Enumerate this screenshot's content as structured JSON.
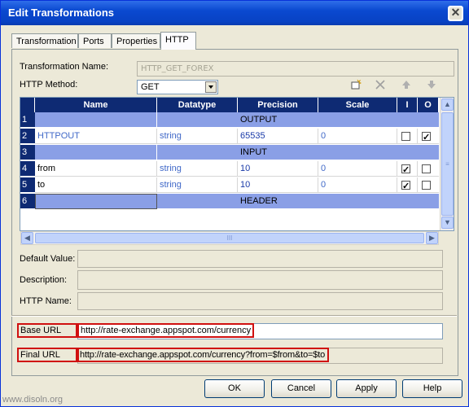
{
  "window": {
    "title": "Edit Transformations",
    "close_glyph": "✕"
  },
  "tabs": [
    {
      "label": "Transformation"
    },
    {
      "label": "Ports"
    },
    {
      "label": "Properties"
    },
    {
      "label": "HTTP"
    }
  ],
  "form": {
    "transformation_name_label": "Transformation Name:",
    "transformation_name_value": "HTTP_GET_FOREX",
    "http_method_label": "HTTP Method:",
    "http_method_value": "GET"
  },
  "toolbar_icons": [
    "new-port-icon",
    "delete-icon",
    "move-up-icon",
    "move-down-icon"
  ],
  "grid": {
    "columns": [
      "Name",
      "Datatype",
      "Precision",
      "Scale",
      "I",
      "O"
    ],
    "rows": [
      {
        "num": "1",
        "group": "OUTPUT"
      },
      {
        "num": "2",
        "name": "HTTPOUT",
        "datatype": "string",
        "precision": "65535",
        "scale": "0",
        "i": false,
        "o": true
      },
      {
        "num": "3",
        "group": "INPUT"
      },
      {
        "num": "4",
        "name": "from",
        "datatype": "string",
        "precision": "10",
        "scale": "0",
        "i": true,
        "o": false
      },
      {
        "num": "5",
        "name": "to",
        "datatype": "string",
        "precision": "10",
        "scale": "0",
        "i": true,
        "o": false
      },
      {
        "num": "6",
        "group": "HEADER"
      }
    ],
    "hscroll_grip": "III"
  },
  "details": {
    "default_value_label": "Default Value:",
    "description_label": "Description:",
    "http_name_label": "HTTP Name:"
  },
  "urls": {
    "base_label": "Base URL",
    "base_value": "http://rate-exchange.appspot.com/currency",
    "final_label": "Final URL",
    "final_value": "http://rate-exchange.appspot.com/currency?from=$from&to=$to"
  },
  "buttons": {
    "ok": "OK",
    "cancel": "Cancel",
    "apply": "Apply",
    "help": "Help"
  },
  "watermark": "www.disoln.org",
  "colors": {
    "title_bar": "#0a49d0",
    "grid_header": "#0e2a73",
    "group_row": "#8a9fe6",
    "highlight_box": "#d01010"
  }
}
